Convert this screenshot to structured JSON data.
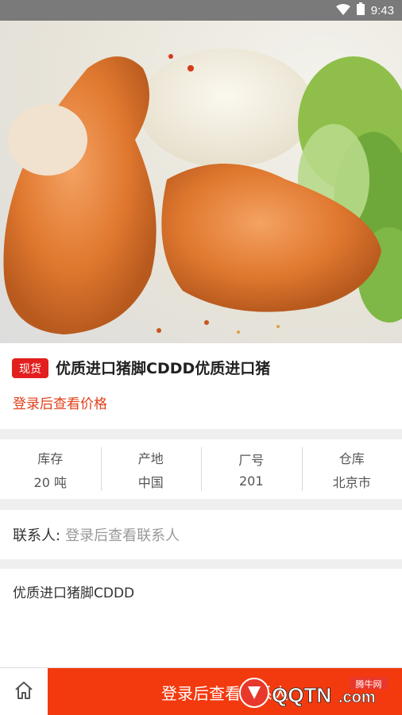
{
  "status_bar": {
    "time": "9:43"
  },
  "product": {
    "badge": "现货",
    "title": "优质进口猪脚CDDD优质进口猪",
    "price_note": "登录后查看价格",
    "description": "优质进口猪脚CDDD"
  },
  "stats": [
    {
      "label": "库存",
      "value": "20 吨"
    },
    {
      "label": "产地",
      "value": "中国"
    },
    {
      "label": "厂号",
      "value": "201"
    },
    {
      "label": "仓库",
      "value": "北京市"
    }
  ],
  "contact": {
    "label": "联系人:",
    "value": "登录后查看联系人"
  },
  "bottom_bar": {
    "login_label": "登录后查看联系人"
  },
  "watermark": {
    "brand": "QQTN.com",
    "cn": "腾牛网"
  },
  "colors": {
    "accent": "#f33a0f",
    "badge": "#e31e1e",
    "price": "#e0401a"
  }
}
